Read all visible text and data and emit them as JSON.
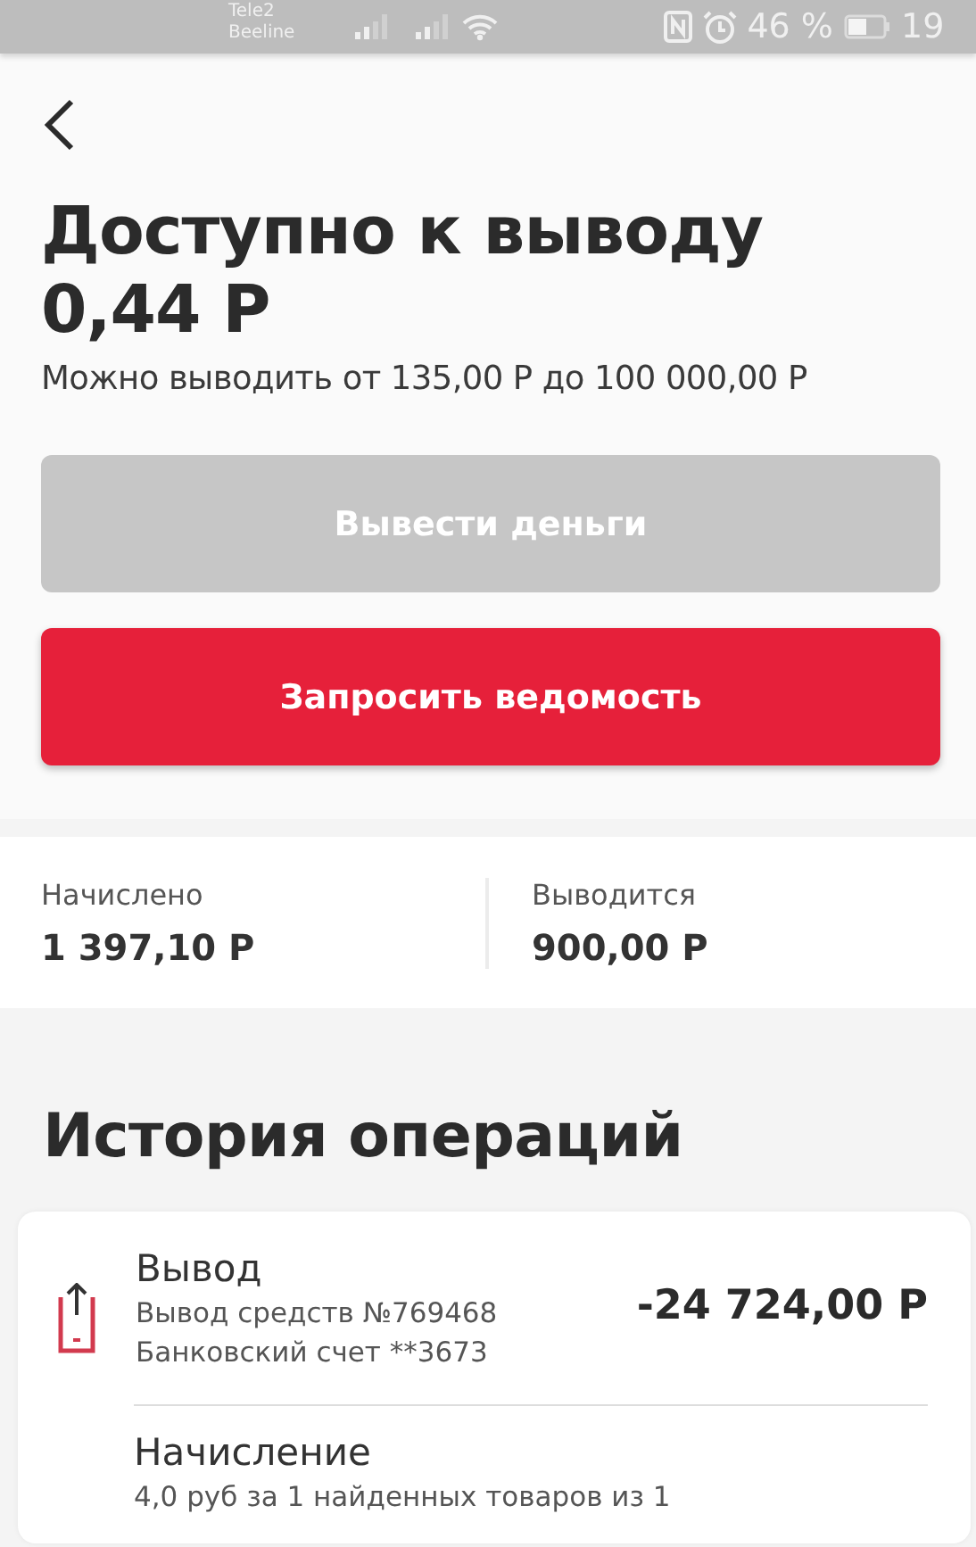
{
  "status_bar": {
    "carriers": [
      "Tele2",
      "Beeline"
    ],
    "battery": "46 %",
    "time": "19"
  },
  "header": {
    "title": "Доступно к выводу",
    "amount": "0,44 Р",
    "limits": "Можно выводить от 135,00 Р до 100 000,00 Р"
  },
  "buttons": [
    {
      "label": "Вывести деньги",
      "disabled": true
    },
    {
      "label": "Запросить ведомость",
      "disabled": false
    }
  ],
  "stats": [
    {
      "label": "Начислено",
      "value": "1 397,10 Р"
    },
    {
      "label": "Выводится",
      "value": "900,00 Р"
    }
  ],
  "history": {
    "title": "История операций",
    "operations": [
      {
        "kind": "withdrawal",
        "title": "Вывод",
        "lines": [
          "Вывод средств №769468",
          "Банковский счет **3673"
        ],
        "amount": "-24 724,00 Р"
      },
      {
        "kind": "accrual",
        "title": "Начисление",
        "lines": [
          "4,0 руб за 1 найденных товаров из 1"
        ]
      }
    ]
  }
}
